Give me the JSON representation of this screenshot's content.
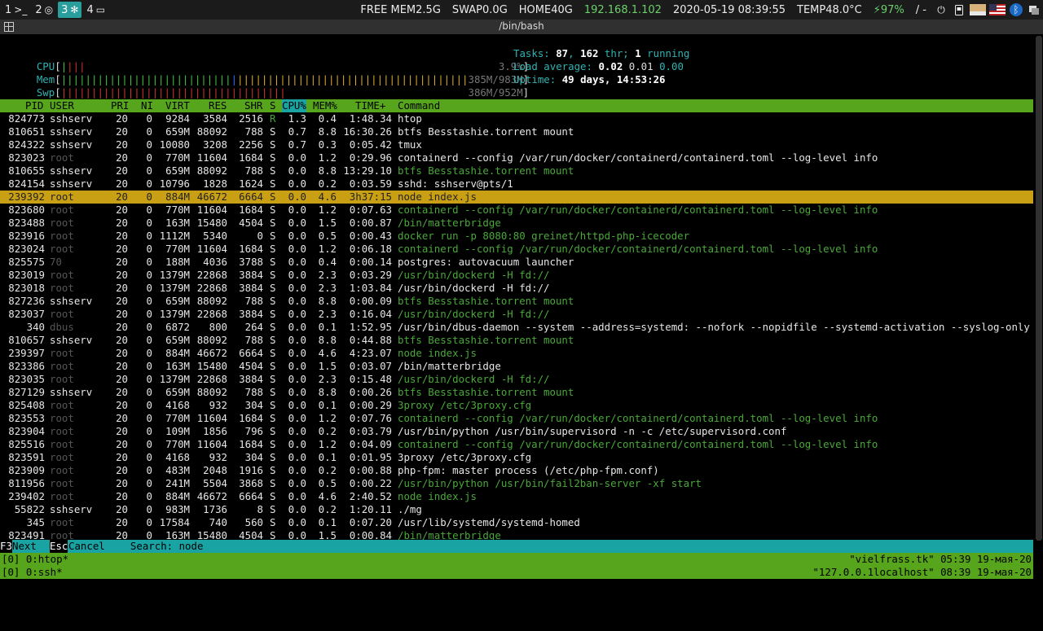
{
  "topbar": {
    "workspaces": [
      {
        "num": "1",
        "icon": "terminal-icon",
        "glyph": ">_",
        "active": false
      },
      {
        "num": "2",
        "icon": "browser-icon",
        "glyph": "◎",
        "active": false
      },
      {
        "num": "3",
        "icon": "settings-icon",
        "glyph": "✻",
        "active": true
      },
      {
        "num": "4",
        "icon": "chat-icon",
        "glyph": "▭",
        "active": false
      }
    ],
    "stats": {
      "free_mem": "FREE MEM2.5G",
      "swap": "SWAP0.0G",
      "home": "HOME40G",
      "ip": "192.168.1.102",
      "datetime": "2020-05-19 08:39:55",
      "temp": "TEMP48.0°C",
      "battery": "⚡97%",
      "disk": "/ -"
    },
    "colors": {
      "ip": "#6cd16c",
      "battery": "#6cd16c",
      "active_ws": "#2a9d9d"
    }
  },
  "window": {
    "title": "/bin/bash"
  },
  "meters": {
    "cpu": {
      "label": "CPU",
      "value": "3.9%"
    },
    "mem": {
      "label": "Mem",
      "value": "385M/983M"
    },
    "swp": {
      "label": "Swp",
      "value": "386M/952M"
    }
  },
  "info": {
    "tasks_prefix": "Tasks: ",
    "tasks": "87",
    "tasks_sep": ", ",
    "threads": "162",
    "tasks_suffix": " thr; ",
    "running": "1",
    "running_suffix": " running",
    "load_prefix": "Load average: ",
    "load1": "0.02",
    "load5": "0.01",
    "load15": "0.00",
    "uptime_prefix": "Uptime: ",
    "uptime": "49 days, 14:53:26"
  },
  "header": {
    "pid": "PID",
    "user": "USER",
    "pri": "PRI",
    "ni": "NI",
    "virt": "VIRT",
    "res": "RES",
    "shr": "SHR",
    "s": "S",
    "cpu": "CPU%",
    "mem": "MEM%",
    "time": "TIME+",
    "command": "Command"
  },
  "processes": [
    {
      "pid": "824773",
      "user": "sshserv",
      "pri": "20",
      "ni": "0",
      "virt": "9284",
      "res": "3584",
      "shr": "2516",
      "s": "R",
      "cpu": "1.3",
      "mem": "0.4",
      "time": "1:48.34",
      "cmd": "htop",
      "cmdc": "w",
      "userc": "w"
    },
    {
      "pid": "810651",
      "user": "sshserv",
      "pri": "20",
      "ni": "0",
      "virt": "659M",
      "res": "88092",
      "shr": "788",
      "s": "S",
      "cpu": "0.7",
      "mem": "8.8",
      "time": "16:30.26",
      "cmd": "btfs Besstashie.torrent mount",
      "cmdc": "w",
      "userc": "w"
    },
    {
      "pid": "824322",
      "user": "sshserv",
      "pri": "20",
      "ni": "0",
      "virt": "10080",
      "res": "3208",
      "shr": "2256",
      "s": "S",
      "cpu": "0.7",
      "mem": "0.3",
      "time": "0:05.42",
      "cmd": "tmux",
      "cmdc": "w",
      "userc": "w"
    },
    {
      "pid": "823023",
      "user": "root",
      "pri": "20",
      "ni": "0",
      "virt": "770M",
      "res": "11604",
      "shr": "1684",
      "s": "S",
      "cpu": "0.0",
      "mem": "1.2",
      "time": "0:29.96",
      "cmd": "containerd --config /var/run/docker/containerd/containerd.toml --log-level info",
      "cmdc": "w",
      "userc": "dim"
    },
    {
      "pid": "810655",
      "user": "sshserv",
      "pri": "20",
      "ni": "0",
      "virt": "659M",
      "res": "88092",
      "shr": "788",
      "s": "S",
      "cpu": "0.0",
      "mem": "8.8",
      "time": "13:29.10",
      "cmd": "btfs Besstashie.torrent mount",
      "cmdc": "green",
      "userc": "w"
    },
    {
      "pid": "824154",
      "user": "sshserv",
      "pri": "20",
      "ni": "0",
      "virt": "10796",
      "res": "1828",
      "shr": "1624",
      "s": "S",
      "cpu": "0.0",
      "mem": "0.2",
      "time": "0:03.59",
      "cmd": "sshd: sshserv@pts/1",
      "cmdc": "w",
      "userc": "w"
    },
    {
      "pid": "239392",
      "user": "root",
      "pri": "20",
      "ni": "0",
      "virt": "884M",
      "res": "46672",
      "shr": "6664",
      "s": "S",
      "cpu": "0.0",
      "mem": "4.6",
      "time": "3h37:15",
      "cmd": "node index.js",
      "cmdc": "w",
      "userc": "w",
      "selected": true
    },
    {
      "pid": "823680",
      "user": "root",
      "pri": "20",
      "ni": "0",
      "virt": "770M",
      "res": "11604",
      "shr": "1684",
      "s": "S",
      "cpu": "0.0",
      "mem": "1.2",
      "time": "0:07.63",
      "cmd": "containerd --config /var/run/docker/containerd/containerd.toml --log-level info",
      "cmdc": "green",
      "userc": "dim"
    },
    {
      "pid": "823488",
      "user": "root",
      "pri": "20",
      "ni": "0",
      "virt": "163M",
      "res": "15480",
      "shr": "4504",
      "s": "S",
      "cpu": "0.0",
      "mem": "1.5",
      "time": "0:00.87",
      "cmd": "/bin/matterbridge",
      "cmdc": "green",
      "userc": "dim"
    },
    {
      "pid": "823916",
      "user": "root",
      "pri": "20",
      "ni": "0",
      "virt": "1112M",
      "res": "5340",
      "shr": "0",
      "s": "S",
      "cpu": "0.0",
      "mem": "0.5",
      "time": "0:00.43",
      "cmd": "docker run -p 8080:80 greinet/httpd-php-icecoder",
      "cmdc": "green",
      "userc": "dim"
    },
    {
      "pid": "823024",
      "user": "root",
      "pri": "20",
      "ni": "0",
      "virt": "770M",
      "res": "11604",
      "shr": "1684",
      "s": "S",
      "cpu": "0.0",
      "mem": "1.2",
      "time": "0:06.18",
      "cmd": "containerd --config /var/run/docker/containerd/containerd.toml --log-level info",
      "cmdc": "green",
      "userc": "dim"
    },
    {
      "pid": "825575",
      "user": "70",
      "pri": "20",
      "ni": "0",
      "virt": "188M",
      "res": "4036",
      "shr": "3788",
      "s": "S",
      "cpu": "0.0",
      "mem": "0.4",
      "time": "0:00.14",
      "cmd": "postgres: autovacuum launcher",
      "cmdc": "w",
      "userc": "dim"
    },
    {
      "pid": "823019",
      "user": "root",
      "pri": "20",
      "ni": "0",
      "virt": "1379M",
      "res": "22868",
      "shr": "3884",
      "s": "S",
      "cpu": "0.0",
      "mem": "2.3",
      "time": "0:03.29",
      "cmd": "/usr/bin/dockerd -H fd://",
      "cmdc": "green",
      "userc": "dim"
    },
    {
      "pid": "823018",
      "user": "root",
      "pri": "20",
      "ni": "0",
      "virt": "1379M",
      "res": "22868",
      "shr": "3884",
      "s": "S",
      "cpu": "0.0",
      "mem": "2.3",
      "time": "1:03.84",
      "cmd": "/usr/bin/dockerd -H fd://",
      "cmdc": "w",
      "userc": "dim"
    },
    {
      "pid": "827236",
      "user": "sshserv",
      "pri": "20",
      "ni": "0",
      "virt": "659M",
      "res": "88092",
      "shr": "788",
      "s": "S",
      "cpu": "0.0",
      "mem": "8.8",
      "time": "0:00.09",
      "cmd": "btfs Besstashie.torrent mount",
      "cmdc": "green",
      "userc": "w"
    },
    {
      "pid": "823037",
      "user": "root",
      "pri": "20",
      "ni": "0",
      "virt": "1379M",
      "res": "22868",
      "shr": "3884",
      "s": "S",
      "cpu": "0.0",
      "mem": "2.3",
      "time": "0:16.04",
      "cmd": "/usr/bin/dockerd -H fd://",
      "cmdc": "green",
      "userc": "dim"
    },
    {
      "pid": "340",
      "user": "dbus",
      "pri": "20",
      "ni": "0",
      "virt": "6872",
      "res": "800",
      "shr": "264",
      "s": "S",
      "cpu": "0.0",
      "mem": "0.1",
      "time": "1:52.95",
      "cmd": "/usr/bin/dbus-daemon --system --address=systemd: --nofork --nopidfile --systemd-activation --syslog-only",
      "cmdc": "w",
      "userc": "dim"
    },
    {
      "pid": "810657",
      "user": "sshserv",
      "pri": "20",
      "ni": "0",
      "virt": "659M",
      "res": "88092",
      "shr": "788",
      "s": "S",
      "cpu": "0.0",
      "mem": "8.8",
      "time": "0:44.88",
      "cmd": "btfs Besstashie.torrent mount",
      "cmdc": "green",
      "userc": "w"
    },
    {
      "pid": "239397",
      "user": "root",
      "pri": "20",
      "ni": "0",
      "virt": "884M",
      "res": "46672",
      "shr": "6664",
      "s": "S",
      "cpu": "0.0",
      "mem": "4.6",
      "time": "4:23.07",
      "cmd": "node index.js",
      "cmdc": "green",
      "userc": "dim"
    },
    {
      "pid": "823386",
      "user": "root",
      "pri": "20",
      "ni": "0",
      "virt": "163M",
      "res": "15480",
      "shr": "4504",
      "s": "S",
      "cpu": "0.0",
      "mem": "1.5",
      "time": "0:03.07",
      "cmd": "/bin/matterbridge",
      "cmdc": "w",
      "userc": "dim"
    },
    {
      "pid": "823035",
      "user": "root",
      "pri": "20",
      "ni": "0",
      "virt": "1379M",
      "res": "22868",
      "shr": "3884",
      "s": "S",
      "cpu": "0.0",
      "mem": "2.3",
      "time": "0:15.48",
      "cmd": "/usr/bin/dockerd -H fd://",
      "cmdc": "green",
      "userc": "dim"
    },
    {
      "pid": "827129",
      "user": "sshserv",
      "pri": "20",
      "ni": "0",
      "virt": "659M",
      "res": "88092",
      "shr": "788",
      "s": "S",
      "cpu": "0.0",
      "mem": "8.8",
      "time": "0:00.26",
      "cmd": "btfs Besstashie.torrent mount",
      "cmdc": "green",
      "userc": "w"
    },
    {
      "pid": "825408",
      "user": "root",
      "pri": "20",
      "ni": "0",
      "virt": "4168",
      "res": "932",
      "shr": "304",
      "s": "S",
      "cpu": "0.0",
      "mem": "0.1",
      "time": "0:00.29",
      "cmd": "3proxy /etc/3proxy.cfg",
      "cmdc": "green",
      "userc": "dim"
    },
    {
      "pid": "823553",
      "user": "root",
      "pri": "20",
      "ni": "0",
      "virt": "770M",
      "res": "11604",
      "shr": "1684",
      "s": "S",
      "cpu": "0.0",
      "mem": "1.2",
      "time": "0:07.76",
      "cmd": "containerd --config /var/run/docker/containerd/containerd.toml --log-level info",
      "cmdc": "green",
      "userc": "dim"
    },
    {
      "pid": "823904",
      "user": "root",
      "pri": "20",
      "ni": "0",
      "virt": "109M",
      "res": "1856",
      "shr": "796",
      "s": "S",
      "cpu": "0.0",
      "mem": "0.2",
      "time": "0:03.79",
      "cmd": "/usr/bin/python /usr/bin/supervisord -n -c /etc/supervisord.conf",
      "cmdc": "w",
      "userc": "dim"
    },
    {
      "pid": "825516",
      "user": "root",
      "pri": "20",
      "ni": "0",
      "virt": "770M",
      "res": "11604",
      "shr": "1684",
      "s": "S",
      "cpu": "0.0",
      "mem": "1.2",
      "time": "0:04.09",
      "cmd": "containerd --config /var/run/docker/containerd/containerd.toml --log-level info",
      "cmdc": "green",
      "userc": "dim"
    },
    {
      "pid": "823591",
      "user": "root",
      "pri": "20",
      "ni": "0",
      "virt": "4168",
      "res": "932",
      "shr": "304",
      "s": "S",
      "cpu": "0.0",
      "mem": "0.1",
      "time": "0:01.95",
      "cmd": "3proxy /etc/3proxy.cfg",
      "cmdc": "w",
      "userc": "dim"
    },
    {
      "pid": "823909",
      "user": "root",
      "pri": "20",
      "ni": "0",
      "virt": "483M",
      "res": "2048",
      "shr": "1916",
      "s": "S",
      "cpu": "0.0",
      "mem": "0.2",
      "time": "0:00.88",
      "cmd": "php-fpm: master process (/etc/php-fpm.conf)",
      "cmdc": "w",
      "userc": "dim"
    },
    {
      "pid": "811956",
      "user": "root",
      "pri": "20",
      "ni": "0",
      "virt": "241M",
      "res": "5504",
      "shr": "3868",
      "s": "S",
      "cpu": "0.0",
      "mem": "0.5",
      "time": "0:00.22",
      "cmd": "/usr/bin/python /usr/bin/fail2ban-server -xf start",
      "cmdc": "green",
      "userc": "dim"
    },
    {
      "pid": "239402",
      "user": "root",
      "pri": "20",
      "ni": "0",
      "virt": "884M",
      "res": "46672",
      "shr": "6664",
      "s": "S",
      "cpu": "0.0",
      "mem": "4.6",
      "time": "2:40.52",
      "cmd": "node index.js",
      "cmdc": "green",
      "userc": "dim"
    },
    {
      "pid": "55822",
      "user": "sshserv",
      "pri": "20",
      "ni": "0",
      "virt": "983M",
      "res": "1736",
      "shr": "8",
      "s": "S",
      "cpu": "0.0",
      "mem": "0.2",
      "time": "1:20.11",
      "cmd": "./mg",
      "cmdc": "w",
      "userc": "w"
    },
    {
      "pid": "345",
      "user": "root",
      "pri": "20",
      "ni": "0",
      "virt": "17584",
      "res": "740",
      "shr": "560",
      "s": "S",
      "cpu": "0.0",
      "mem": "0.1",
      "time": "0:07.20",
      "cmd": "/usr/lib/systemd/systemd-homed",
      "cmdc": "w",
      "userc": "dim"
    },
    {
      "pid": "823491",
      "user": "root",
      "pri": "20",
      "ni": "0",
      "virt": "163M",
      "res": "15480",
      "shr": "4504",
      "s": "S",
      "cpu": "0.0",
      "mem": "1.5",
      "time": "0:00.84",
      "cmd": "/bin/matterbridge",
      "cmdc": "green",
      "userc": "dim"
    }
  ],
  "fbar": {
    "k1": "F3",
    "l1": "Next  ",
    "k2": "Esc",
    "l2": "Cancel  ",
    "search": "  Search: node"
  },
  "tmux": [
    {
      "left": "[0] 0:htop*",
      "right": "\"vielfrass.tk\" 05:39 19-мая-20"
    },
    {
      "left": "[0] 0:ssh*",
      "right": "\"127.0.0.1localhost\" 08:39 19-мая-20"
    }
  ]
}
